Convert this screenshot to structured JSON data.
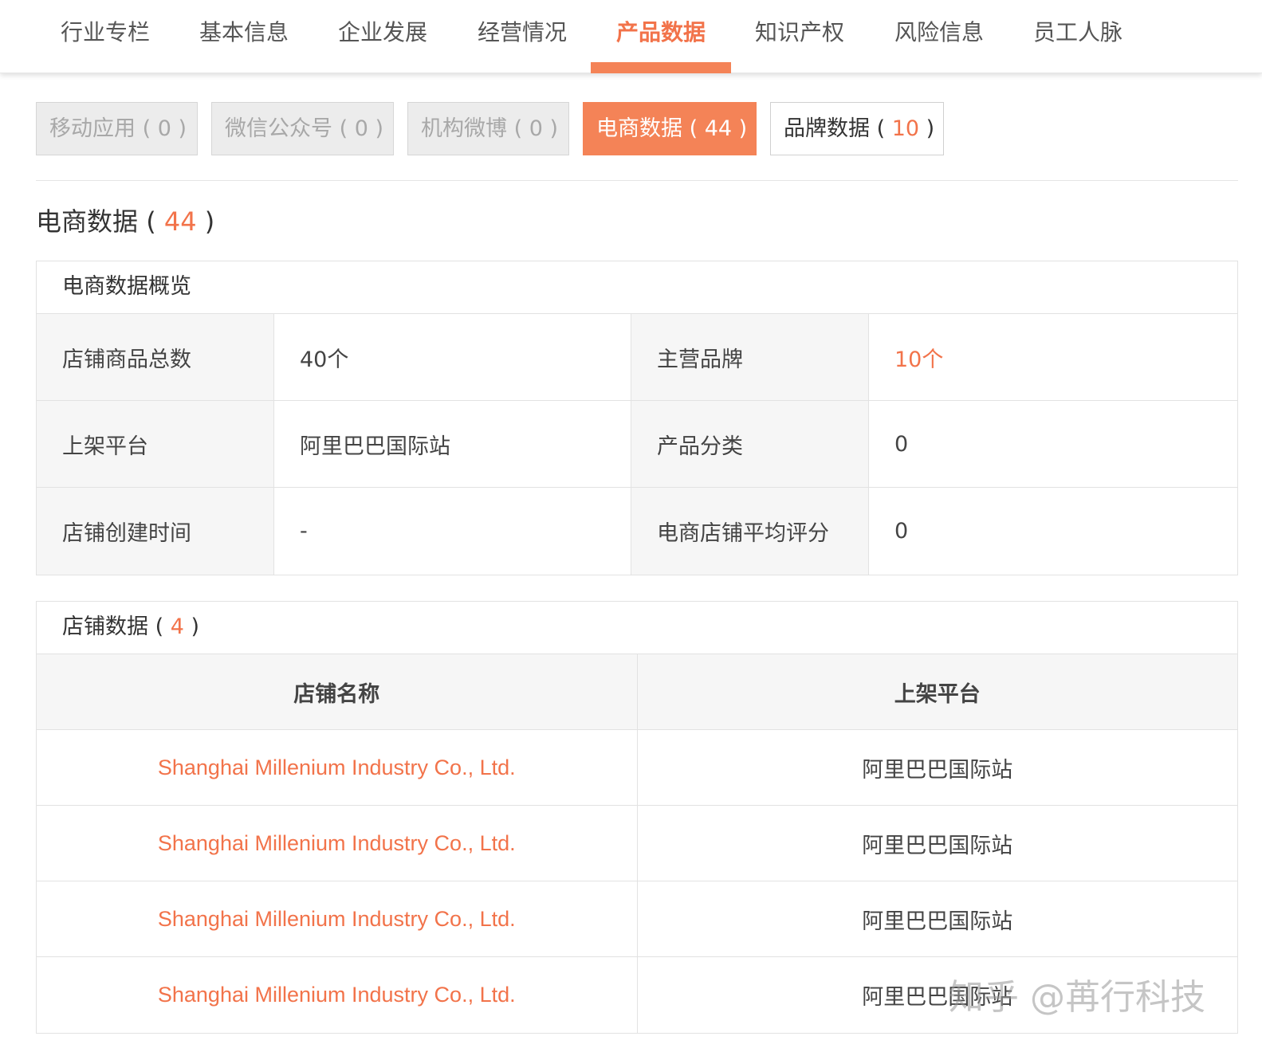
{
  "topnav": {
    "items": [
      {
        "label": "行业专栏"
      },
      {
        "label": "基本信息"
      },
      {
        "label": "企业发展"
      },
      {
        "label": "经营情况"
      },
      {
        "label": "产品数据"
      },
      {
        "label": "知识产权"
      },
      {
        "label": "风险信息"
      },
      {
        "label": "员工人脉"
      }
    ],
    "active_index": 4
  },
  "subtabs": [
    {
      "label": "移动应用",
      "count": "0",
      "state": "disabled"
    },
    {
      "label": "微信公众号",
      "count": "0",
      "state": "disabled"
    },
    {
      "label": "机构微博",
      "count": "0",
      "state": "disabled"
    },
    {
      "label": "电商数据",
      "count": "44",
      "state": "active"
    },
    {
      "label": "品牌数据",
      "count": "10",
      "state": "normal"
    }
  ],
  "section": {
    "title": "电商数据",
    "count": "44"
  },
  "overview": {
    "title": "电商数据概览",
    "rows": [
      [
        {
          "label": "店铺商品总数",
          "value": "40个"
        },
        {
          "label": "主营品牌",
          "value": "10个",
          "accent": true
        }
      ],
      [
        {
          "label": "上架平台",
          "value": "阿里巴巴国际站"
        },
        {
          "label": "产品分类",
          "value": "0"
        }
      ],
      [
        {
          "label": "店铺创建时间",
          "value": "-"
        },
        {
          "label": "电商店铺平均评分",
          "value": "0"
        }
      ]
    ]
  },
  "stores": {
    "title": "店铺数据",
    "count": "4",
    "headers": [
      "店铺名称",
      "上架平台"
    ],
    "rows": [
      {
        "name": "Shanghai Millenium Industry Co., Ltd.",
        "platform": "阿里巴巴国际站"
      },
      {
        "name": "Shanghai Millenium Industry Co., Ltd.",
        "platform": "阿里巴巴国际站"
      },
      {
        "name": "Shanghai Millenium Industry Co., Ltd.",
        "platform": "阿里巴巴国际站"
      },
      {
        "name": "Shanghai Millenium Industry Co., Ltd.",
        "platform": "阿里巴巴国际站"
      }
    ]
  },
  "watermark": "知乎 @苒行科技",
  "colors": {
    "accent": "#f48357",
    "accent_text": "#f2734a",
    "label_bg": "#f6f6f6",
    "disabled_bg": "#ececec"
  }
}
